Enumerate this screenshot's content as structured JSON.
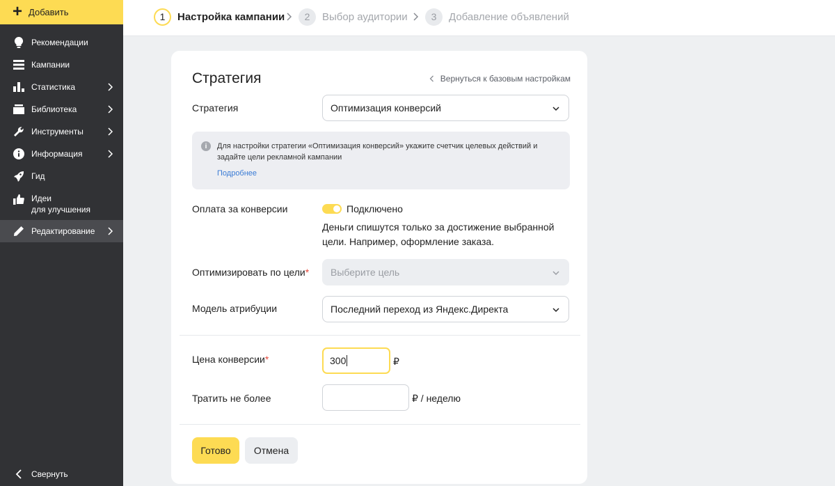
{
  "sidebar": {
    "add_label": "Добавить",
    "items": [
      {
        "label": "Рекомендации",
        "icon": "lightbulb-icon"
      },
      {
        "label": "Кампании",
        "icon": "list-icon"
      },
      {
        "label": "Статистика",
        "icon": "bar-chart-icon"
      },
      {
        "label": "Библиотека",
        "icon": "library-icon"
      },
      {
        "label": "Инструменты",
        "icon": "wrench-icon"
      },
      {
        "label": "Информация",
        "icon": "info-icon"
      },
      {
        "label": "Гид",
        "icon": "rocket-icon"
      },
      {
        "label": "Идеи",
        "label2": "для улучшения",
        "icon": "thumbs-up-icon"
      },
      {
        "label": "Редактирование",
        "icon": "pencil-icon"
      }
    ],
    "collapse_label": "Свернуть"
  },
  "stepper": {
    "steps": [
      {
        "num": "1",
        "label": "Настройка кампании",
        "state": "active"
      },
      {
        "num": "2",
        "label": "Выбор аудитории",
        "state": "inactive"
      },
      {
        "num": "3",
        "label": "Добавление объявлений",
        "state": "inactive"
      }
    ]
  },
  "card": {
    "title": "Стратегия",
    "back_link": "Вернуться к базовым настройкам",
    "strategy": {
      "label": "Стратегия",
      "value": "Оптимизация конверсий"
    },
    "info": {
      "text": "Для настройки стратегии «Оптимизация конверсий» укажите счетчик целевых действий и задайте цели рекламной кампании",
      "more": "Подробнее"
    },
    "payment": {
      "label": "Оплата за конверсии",
      "toggle_state": "Подключено",
      "toggle_on": true,
      "description": "Деньги спишутся только за достижение выбранной цели. Например, оформление заказа."
    },
    "goal": {
      "label": "Оптимизировать по цели",
      "required": "*",
      "placeholder": "Выберите цель"
    },
    "attribution": {
      "label": "Модель атрибуции",
      "value": "Последний переход из Яндекс.Директа"
    },
    "price": {
      "label": "Цена конверсии",
      "required": "*",
      "value": "300",
      "unit": "₽"
    },
    "spend": {
      "label": "Тратить не более",
      "value": "",
      "unit": "₽ / неделю"
    },
    "buttons": {
      "done": "Готово",
      "cancel": "Отмена"
    }
  },
  "colors": {
    "accent": "#fddb53",
    "sidebar_bg": "#313235",
    "link": "#3a7bd5",
    "required": "#e5483b"
  }
}
